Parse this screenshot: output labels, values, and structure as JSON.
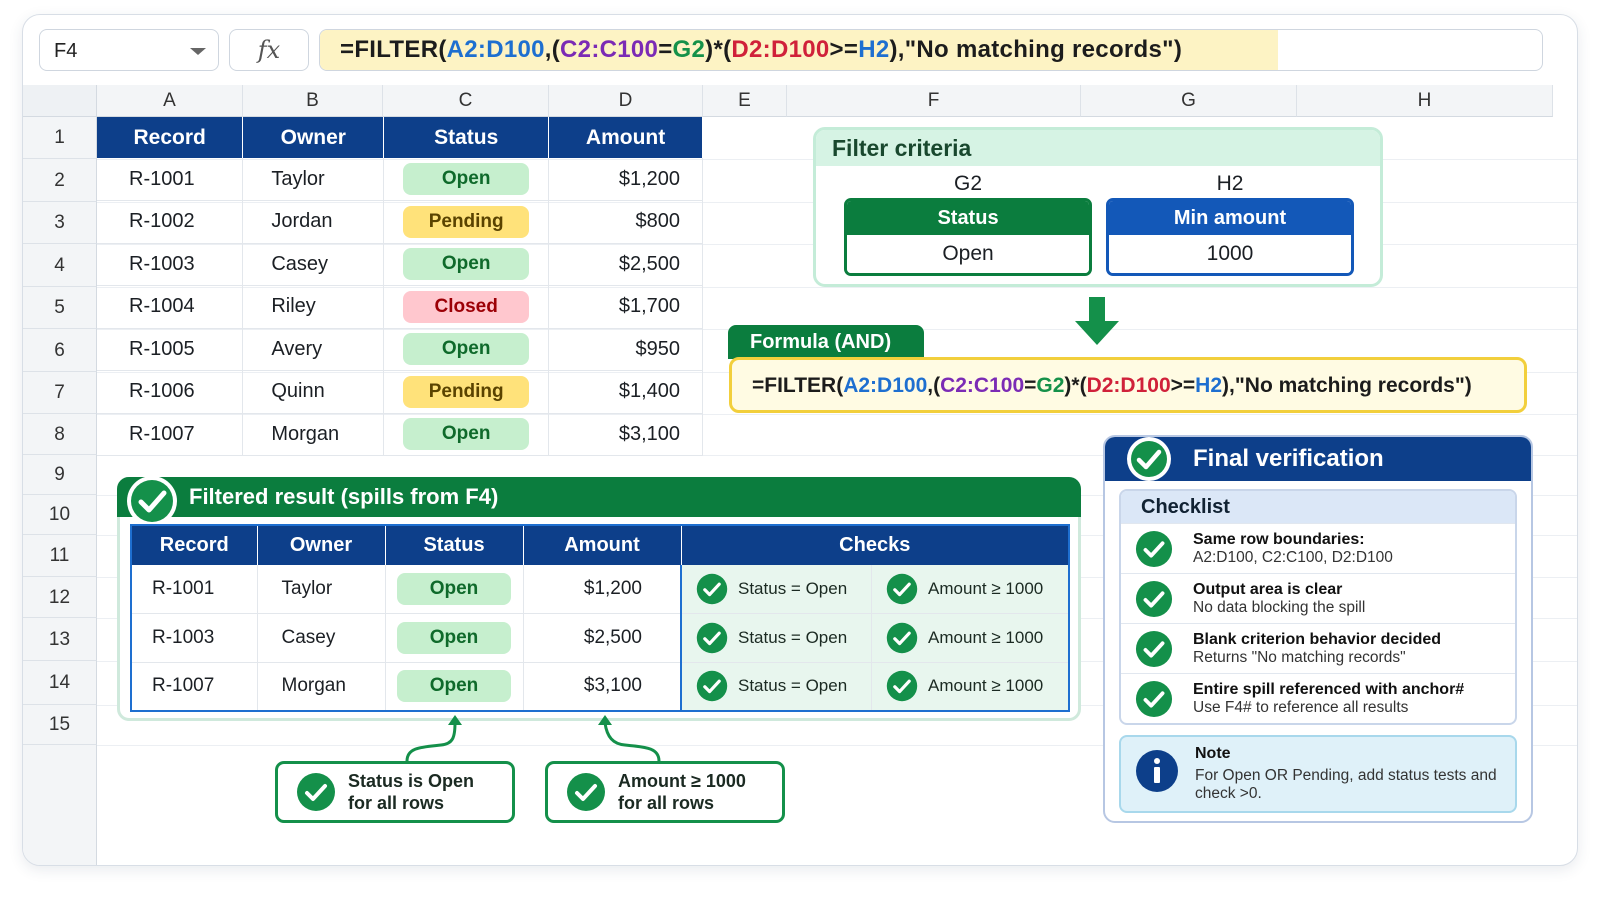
{
  "formula_bar": {
    "name_box": "F4",
    "fx_label": "fx",
    "formula_parts": [
      {
        "text": "=FILTER(",
        "color": "dark"
      },
      {
        "text": "A2:D100",
        "color": "blue"
      },
      {
        "text": ",(",
        "color": "dark"
      },
      {
        "text": "C2:C100",
        "color": "purple"
      },
      {
        "text": "=",
        "color": "dark"
      },
      {
        "text": "G2",
        "color": "green"
      },
      {
        "text": ")*(",
        "color": "dark"
      },
      {
        "text": "D2:D100",
        "color": "red"
      },
      {
        "text": ">=",
        "color": "dark"
      },
      {
        "text": "H2",
        "color": "blue"
      },
      {
        "text": "),\"No matching records\")",
        "color": "dark"
      }
    ]
  },
  "columns": [
    "A",
    "B",
    "C",
    "D",
    "E",
    "F",
    "G",
    "H"
  ],
  "rows": [
    "1",
    "2",
    "3",
    "4",
    "5",
    "6",
    "7",
    "8",
    "9",
    "10",
    "11",
    "12",
    "13",
    "14",
    "15"
  ],
  "source_table": {
    "headers": [
      "Record",
      "Owner",
      "Status",
      "Amount"
    ],
    "rows": [
      {
        "record": "R-1001",
        "owner": "Taylor",
        "status": "Open",
        "amount": "$1,200"
      },
      {
        "record": "R-1002",
        "owner": "Jordan",
        "status": "Pending",
        "amount": "$800"
      },
      {
        "record": "R-1003",
        "owner": "Casey",
        "status": "Open",
        "amount": "$2,500"
      },
      {
        "record": "R-1004",
        "owner": "Riley",
        "status": "Closed",
        "amount": "$1,700"
      },
      {
        "record": "R-1005",
        "owner": "Avery",
        "status": "Open",
        "amount": "$950"
      },
      {
        "record": "R-1006",
        "owner": "Quinn",
        "status": "Pending",
        "amount": "$1,400"
      },
      {
        "record": "R-1007",
        "owner": "Morgan",
        "status": "Open",
        "amount": "$3,100"
      }
    ]
  },
  "criteria": {
    "title": "Filter criteria",
    "status": {
      "ref": "G2",
      "label": "Status",
      "value": "Open"
    },
    "min_amount": {
      "ref": "H2",
      "label": "Min amount",
      "value": "1000"
    }
  },
  "formula_card": {
    "tab": "Formula (AND)"
  },
  "filtered": {
    "title": "Filtered result",
    "subtitle": "(spills from F4)",
    "headers": [
      "Record",
      "Owner",
      "Status",
      "Amount",
      "Checks"
    ],
    "rows": [
      {
        "record": "R-1001",
        "owner": "Taylor",
        "status": "Open",
        "amount": "$1,200",
        "check1": "Status = Open",
        "check2": "Amount ≥ 1000"
      },
      {
        "record": "R-1003",
        "owner": "Casey",
        "status": "Open",
        "amount": "$2,500",
        "check1": "Status = Open",
        "check2": "Amount ≥ 1000"
      },
      {
        "record": "R-1007",
        "owner": "Morgan",
        "status": "Open",
        "amount": "$3,100",
        "check1": "Status = Open",
        "check2": "Amount ≥ 1000"
      }
    ]
  },
  "callouts": [
    {
      "line1": "Status is Open",
      "line2": "for all rows"
    },
    {
      "line1": "Amount ≥ 1000",
      "line2": "for all rows"
    }
  ],
  "verification": {
    "title": "Final verification",
    "checklist_title": "Checklist",
    "items": [
      {
        "title": "Same row boundaries:",
        "detail": "A2:D100, C2:C100, D2:D100"
      },
      {
        "title": "Output area is clear",
        "detail": "No data blocking the spill"
      },
      {
        "title": "Blank criterion behavior decided",
        "detail": "Returns \"No matching records\""
      },
      {
        "title": "Entire spill referenced with anchor#",
        "detail": "Use F4# to reference all results"
      }
    ],
    "note_title": "Note",
    "note_text": "For Open OR Pending, add status tests and check >0."
  },
  "colors": {
    "header_navy": "#0d3f8a",
    "accent_green": "#0b7d3e",
    "open": "#c6efce",
    "pending": "#ffe27a",
    "closed": "#ffc7ce",
    "formula_highlight": "#fdf3c4"
  },
  "icons": [
    "check-circle-icon",
    "info-icon",
    "arrow-down-icon",
    "dropdown-caret-icon",
    "fx-icon"
  ]
}
